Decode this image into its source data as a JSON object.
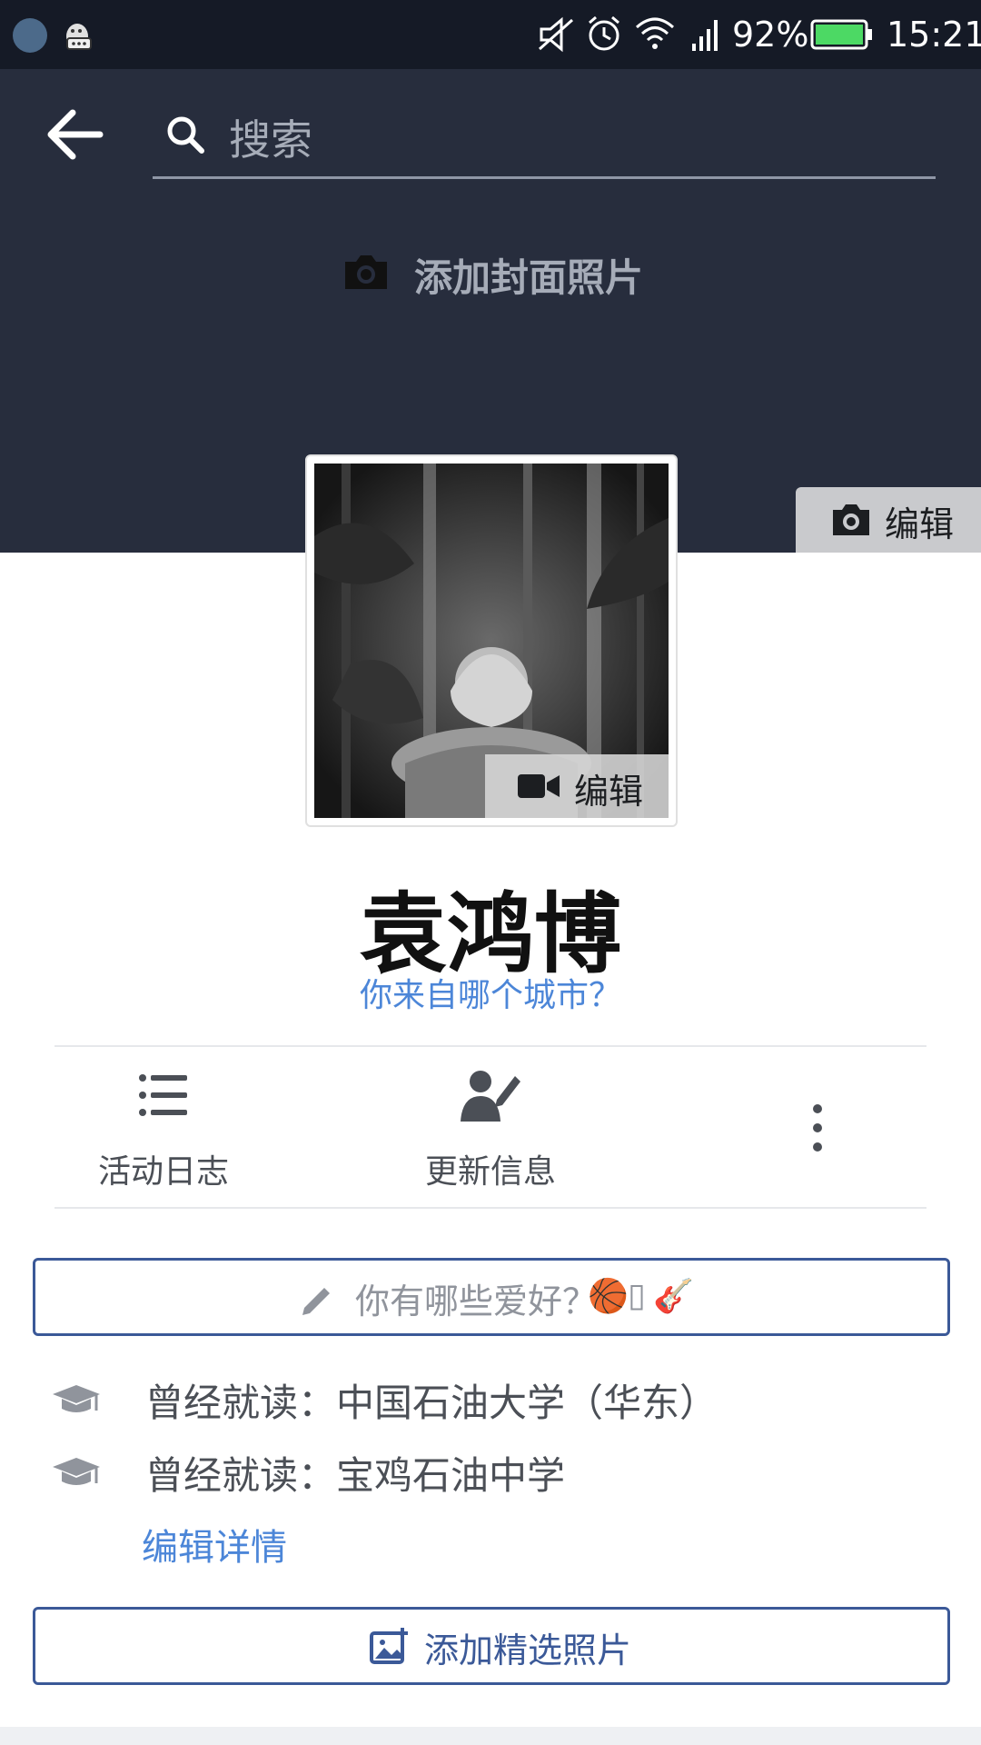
{
  "status_bar": {
    "battery": "92%",
    "time": "15:21"
  },
  "header": {
    "search_placeholder": "搜索"
  },
  "cover": {
    "add_cover_label": "添加封面照片",
    "edit_label": "编辑"
  },
  "profile": {
    "edit_label": "编辑",
    "name": "袁鸿博",
    "city_prompt": "你来自哪个城市？"
  },
  "actions": [
    {
      "label": "活动日志",
      "icon": "list-icon"
    },
    {
      "label": "更新信息",
      "icon": "edit-profile-icon"
    },
    {
      "label": "",
      "icon": "more-icon"
    }
  ],
  "hobbies": {
    "prompt": "你有哪些爱好？",
    "emojis": [
      "🏀",
      "▯",
      "🎸"
    ]
  },
  "education": [
    {
      "label": "曾经就读：中国石油大学（华东）"
    },
    {
      "label": "曾经就读：宝鸡石油中学"
    }
  ],
  "edit_details_label": "编辑详情",
  "add_featured_label": "添加精选照片",
  "colors": {
    "cover_bg": "#272d3d",
    "link_blue": "#4c86d8",
    "brand_blue": "#3b5998"
  }
}
